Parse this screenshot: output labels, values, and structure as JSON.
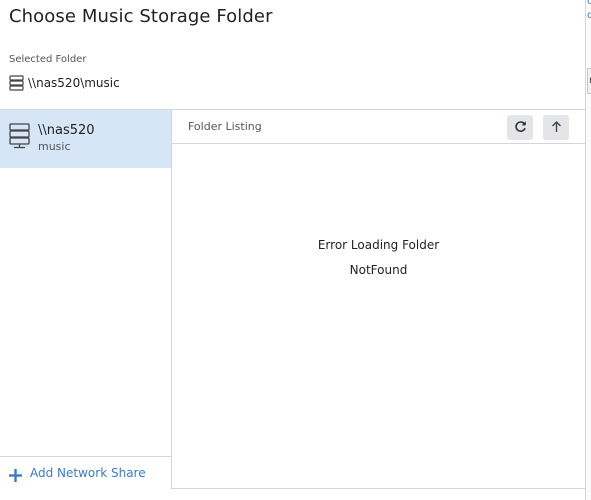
{
  "dialog": {
    "title": "Choose Music Storage Folder",
    "selected_label": "Selected Folder",
    "selected_value": "\\\\nas520\\music"
  },
  "sidebar": {
    "shares": [
      {
        "name": "\\\\nas520",
        "sub": "music",
        "icon": "server-icon",
        "selected": true
      }
    ],
    "add_label": "Add Network Share"
  },
  "listing": {
    "title": "Folder Listing",
    "refresh_icon": "refresh-icon",
    "up_icon": "arrow-up-icon",
    "error_title": "Error Loading Folder",
    "error_detail": "NotFound"
  },
  "background": {
    "link_a": "c",
    "link_b": "c",
    "box_text": "r"
  },
  "colors": {
    "accent": "#3a7bc8",
    "selected_bg": "#d6e6f7",
    "button_bg": "#e3e5e8",
    "border": "#d6d6d6"
  }
}
